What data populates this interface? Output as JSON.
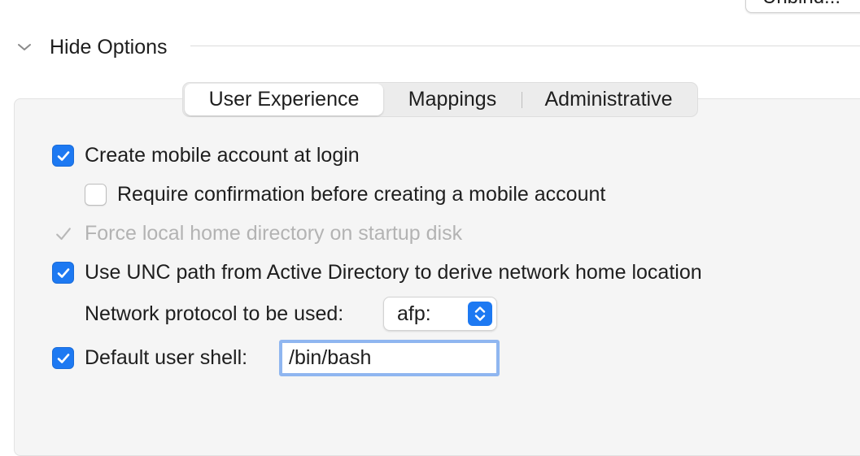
{
  "header": {
    "unbind_label": "Unbind...",
    "disclosure_label": "Hide Options"
  },
  "tabs": [
    {
      "label": "User Experience",
      "selected": true
    },
    {
      "label": "Mappings",
      "selected": false
    },
    {
      "label": "Administrative",
      "selected": false
    }
  ],
  "options": {
    "create_mobile": {
      "label": "Create mobile account at login",
      "checked": true
    },
    "require_confirmation": {
      "label": "Require confirmation before creating a mobile account",
      "checked": false
    },
    "force_local_home": {
      "label": "Force local home directory on startup disk",
      "checked": true,
      "enabled": false
    },
    "use_unc": {
      "label": "Use UNC path from Active Directory to derive network home location",
      "checked": true
    },
    "network_protocol": {
      "label": "Network protocol to be used:",
      "value": "afp:"
    },
    "default_shell": {
      "label": "Default user shell:",
      "checked": true,
      "value": "/bin/bash"
    }
  },
  "colors": {
    "accent": "#1d79f2",
    "focus_ring": "#8fb6f0",
    "disabled_text": "#b3b3b3"
  }
}
